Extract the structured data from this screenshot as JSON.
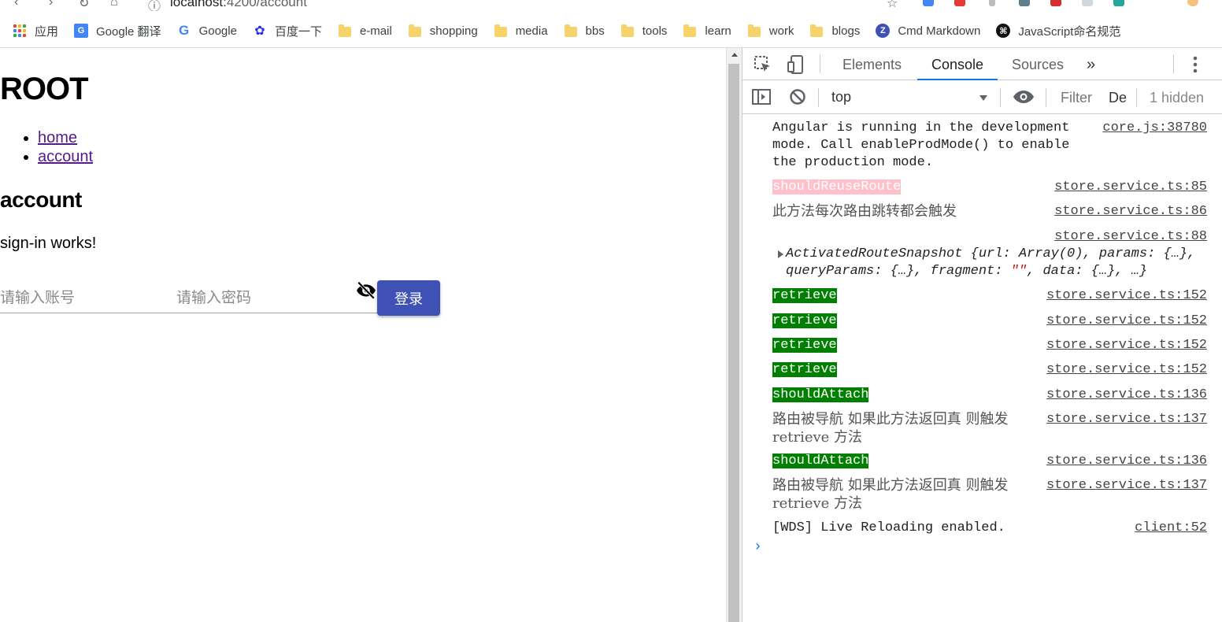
{
  "browser": {
    "address_host": "localhost:",
    "address_path": "4200/account",
    "bookmarks": [
      {
        "label": "应用",
        "icon": "apps-grid-icon"
      },
      {
        "label": "Google 翻译",
        "icon": "google-translate-icon"
      },
      {
        "label": "Google",
        "icon": "google-icon"
      },
      {
        "label": "百度一下",
        "icon": "baidu-icon"
      },
      {
        "label": "e-mail",
        "icon": "folder-icon"
      },
      {
        "label": "shopping",
        "icon": "folder-icon"
      },
      {
        "label": "media",
        "icon": "folder-icon"
      },
      {
        "label": "bbs",
        "icon": "folder-icon"
      },
      {
        "label": "tools",
        "icon": "folder-icon"
      },
      {
        "label": "learn",
        "icon": "folder-icon"
      },
      {
        "label": "work",
        "icon": "folder-icon"
      },
      {
        "label": "blogs",
        "icon": "folder-icon"
      },
      {
        "label": "Cmd Markdown",
        "icon": "cmd-markdown-icon"
      },
      {
        "label": "JavaScript命名规范",
        "icon": "github-icon"
      }
    ]
  },
  "page": {
    "root_title": "ROOT",
    "nav": [
      {
        "label": "home"
      },
      {
        "label": "account"
      }
    ],
    "section_title": "account",
    "status_text": "sign-in works!",
    "account_placeholder": "请输入账号",
    "password_placeholder": "请输入密码",
    "login_label": "登录",
    "accent_color": "#3f51b5"
  },
  "devtools": {
    "tabs": [
      "Elements",
      "Console",
      "Sources"
    ],
    "active_tab": "Console",
    "context": "top",
    "filter_placeholder": "Filter",
    "levels": "De",
    "hidden_count": "1 hidden",
    "logs": [
      {
        "text": "Angular is running in the development mode. Call enableProdMode() to enable the production mode.",
        "source": "core.js:38780"
      },
      {
        "text": "shouldReuseRoute",
        "source": "store.service.ts:85",
        "style": "pink"
      },
      {
        "text": "此方法每次路由跳转都会触发",
        "source": "store.service.ts:86",
        "style": "cn"
      },
      {
        "text": "",
        "source": "store.service.ts:88"
      },
      {
        "text": "ActivatedRouteSnapshot {url: Array(0), params: {…}, queryParams: {…}, fragment: \"\", data: {…}, …}",
        "source": "",
        "style": "object"
      },
      {
        "text": "retrieve",
        "source": "store.service.ts:152",
        "style": "green"
      },
      {
        "text": "retrieve",
        "source": "store.service.ts:152",
        "style": "green"
      },
      {
        "text": "retrieve",
        "source": "store.service.ts:152",
        "style": "green"
      },
      {
        "text": "retrieve",
        "source": "store.service.ts:152",
        "style": "green"
      },
      {
        "text": "shouldAttach",
        "source": "store.service.ts:136",
        "style": "green"
      },
      {
        "text": "路由被导航 如果此方法返回真 则触发 retrieve 方法",
        "source": "store.service.ts:137",
        "style": "cn"
      },
      {
        "text": "shouldAttach",
        "source": "store.service.ts:136",
        "style": "green"
      },
      {
        "text": "路由被导航 如果此方法返回真 则触发 retrieve 方法",
        "source": "store.service.ts:137",
        "style": "cn"
      },
      {
        "text": "[WDS] Live Reloading enabled.",
        "source": "client:52"
      }
    ],
    "prompt_symbol": "›"
  }
}
